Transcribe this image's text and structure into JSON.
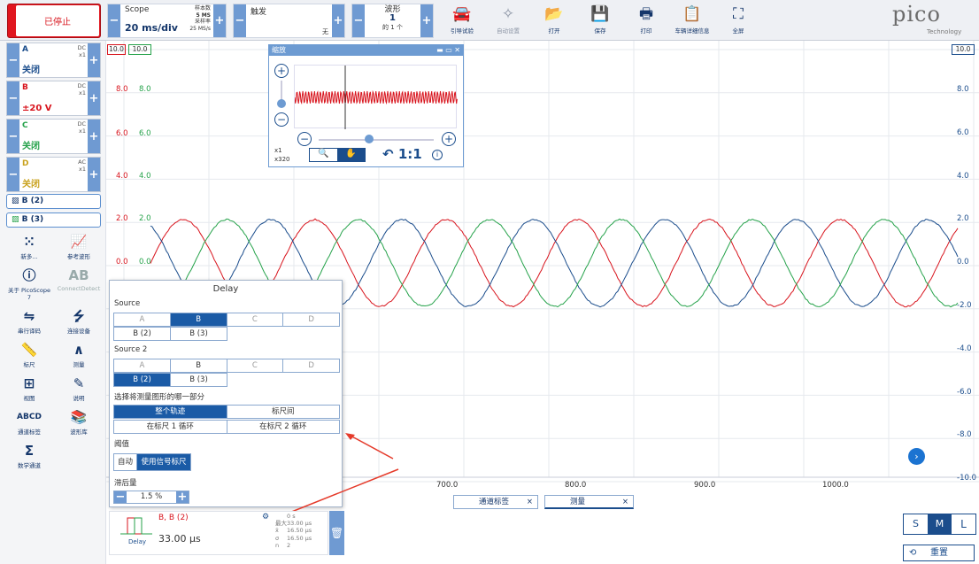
{
  "toolbar": {
    "stop_label": "已停止",
    "scope_label": "Scope",
    "timebase": "20 ms/div",
    "samples_label": "样本数",
    "samples_value": "5 MS",
    "rate_label": "采样率",
    "rate_value": "25 MS/s",
    "trigger_label": "触发",
    "trigger_value": "无",
    "waveform_label": "波形",
    "waveform_count": "1",
    "waveform_of": "的 1 个",
    "buttons": [
      {
        "label": "引导试验",
        "icon": "car-icon"
      },
      {
        "label": "自动设置",
        "icon": "wand-icon"
      },
      {
        "label": "打开",
        "icon": "folder-icon"
      },
      {
        "label": "保存",
        "icon": "save-icon"
      },
      {
        "label": "打印",
        "icon": "printer-icon"
      },
      {
        "label": "车辆详细信息",
        "icon": "clipboard-icon"
      },
      {
        "label": "全屏",
        "icon": "fullscreen-icon"
      }
    ],
    "logo": "pico",
    "logo_sub": "Technology"
  },
  "channels": [
    {
      "name": "A",
      "coupling": "DC",
      "probe": "x1",
      "value": "关闭",
      "color": "#1b4d8c"
    },
    {
      "name": "B",
      "coupling": "DC",
      "probe": "x1",
      "value": "±20 V",
      "color": "#d8141d"
    },
    {
      "name": "C",
      "coupling": "DC",
      "probe": "x1",
      "value": "关闭",
      "color": "#25a24a"
    },
    {
      "name": "D",
      "coupling": "AC",
      "probe": "x1",
      "value": "关闭",
      "color": "#c9a21d"
    }
  ],
  "refs": [
    "B (2)",
    "B (3)"
  ],
  "tools": [
    {
      "label": "新多...",
      "icon": "grid-dots-icon"
    },
    {
      "label": "参考波形",
      "icon": "reference-icon"
    },
    {
      "label": "关于 PicoScope 7",
      "icon": "info-icon"
    },
    {
      "label": "ConnectDetect",
      "icon": "connectdetect-icon"
    },
    {
      "label": "串行译码",
      "icon": "serial-icon"
    },
    {
      "label": "连接设备",
      "icon": "usb-icon"
    },
    {
      "label": "标尺",
      "icon": "ruler-icon"
    },
    {
      "label": "测量",
      "icon": "measure-icon"
    },
    {
      "label": "视图",
      "icon": "view-icon"
    },
    {
      "label": "说明",
      "icon": "notes-icon"
    },
    {
      "label": "通道标签",
      "icon": "abcd-icon"
    },
    {
      "label": "波形库",
      "icon": "library-icon"
    },
    {
      "label": "数学通道",
      "icon": "sigma-icon"
    }
  ],
  "axis": {
    "left_green_top": "10.0",
    "left_red_top": "10.0",
    "right_top": "10.0",
    "left": [
      "8.0",
      "6.0",
      "4.0",
      "2.0",
      "0.0"
    ],
    "right": [
      "8.0",
      "6.0",
      "4.0",
      "2.0",
      "0.0",
      "-2.0",
      "-4.0",
      "-6.0",
      "-8.0",
      "-10.0"
    ],
    "x": [
      "700.0",
      "800.0",
      "900.0",
      "1000.0"
    ]
  },
  "zoom": {
    "title": "缩放",
    "x_label": "x1",
    "x_value": "x320",
    "ratio": "1:1"
  },
  "delay": {
    "title": "Delay",
    "source_label": "Source",
    "source_opts": [
      "A",
      "B",
      "C",
      "D"
    ],
    "source_refs": [
      "B (2)",
      "B (3)"
    ],
    "source2_label": "Source 2",
    "select_part_label": "选择将测量图形的哪一部分",
    "part_opts": [
      "整个轨迹",
      "标尺间",
      "在标尺 1 循环",
      "在标尺 2 循环"
    ],
    "threshold_label": "阈值",
    "thr_opts": [
      "自动",
      "使用信号标尺"
    ],
    "hysteresis_label": "滞后量",
    "hysteresis_value": "1.5 %"
  },
  "measure": {
    "sources": "B, B (2)",
    "name": "Delay",
    "value": "33.00 µs",
    "stats": [
      [
        "",
        "0 s"
      ],
      [
        "最大",
        "33.00 µs"
      ],
      [
        "x̄",
        "16.50 µs"
      ],
      [
        "σ",
        "16.50 µs"
      ],
      [
        "n",
        "2"
      ]
    ]
  },
  "tabs": [
    "通道标签",
    "测量"
  ],
  "size_btns": [
    "S",
    "M",
    "L"
  ],
  "reset": "重置"
}
